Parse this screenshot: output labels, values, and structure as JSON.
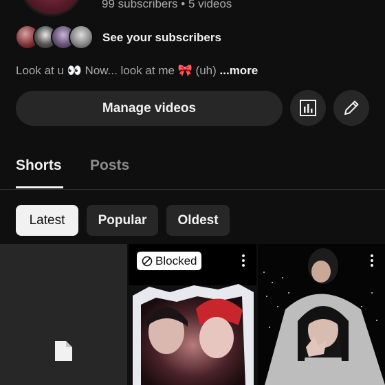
{
  "channel": {
    "subscribers": "99 subscribers",
    "separator": "•",
    "videos": "5 videos",
    "see_subscribers": "See your subscribers",
    "description": "Look at u 👀 Now... look at me 🎀 (uh)",
    "more": " ...more"
  },
  "actions": {
    "manage_videos": "Manage videos",
    "analytics_icon": "analytics-icon",
    "edit_icon": "pencil-icon"
  },
  "tabs": [
    {
      "label": "Shorts",
      "active": true
    },
    {
      "label": "Posts",
      "active": false
    }
  ],
  "filters": [
    {
      "label": "Latest",
      "selected": true
    },
    {
      "label": "Popular",
      "selected": false
    },
    {
      "label": "Oldest",
      "selected": false
    }
  ],
  "shorts": [
    {
      "thumbnail": "file-icon"
    },
    {
      "badge": "Blocked",
      "badge_icon": "blocked-icon",
      "menu_icon": "more-vert-icon"
    },
    {
      "menu_icon": "more-vert-icon"
    }
  ],
  "colors": {
    "background": "#0f0f0f",
    "surface": "#272727",
    "text_primary": "#f1f1f1",
    "text_secondary": "#aaaaaa"
  }
}
